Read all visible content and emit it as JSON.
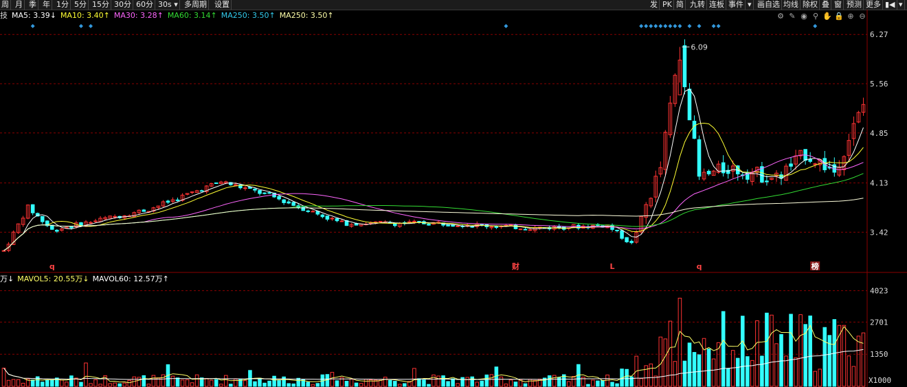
{
  "toolbar": {
    "left_buttons": [
      "周",
      "月",
      "季",
      "年",
      "1分",
      "5分",
      "15分",
      "30分",
      "60分",
      "30s ▾",
      "多周期",
      "设置"
    ],
    "right_buttons": [
      "发",
      "PK",
      "简",
      "九转",
      "连板",
      "事件",
      "▾",
      "画自选",
      "均线",
      "除权",
      "叠",
      "窗",
      "预测",
      "更多",
      "▮◀",
      "▾"
    ]
  },
  "ma_legend": {
    "title_char": "技",
    "items": [
      {
        "text": "MA5: 3.39↓",
        "color": "#ffffff"
      },
      {
        "text": "MA10: 3.40↑",
        "color": "#ffff33"
      },
      {
        "text": "MA30: 3.28↑",
        "color": "#ff66ff"
      },
      {
        "text": "MA60: 3.14↑",
        "color": "#33dd33"
      },
      {
        "text": "MA250: 3.50↑",
        "color": "#33ccee"
      },
      {
        "text": "MA250: 3.50↑",
        "color": "#ffffaa"
      }
    ]
  },
  "vol_legend": {
    "items": [
      {
        "text": "万↓",
        "color": "#ffffff"
      },
      {
        "text": "MAVOL5: 20.55万↓",
        "color": "#ffff66"
      },
      {
        "text": "MAVOL60: 12.57万↑",
        "color": "#ffffff"
      }
    ]
  },
  "tool_icons": [
    "gear-icon",
    "brush-icon",
    "eye-icon",
    "pin-icon",
    "hand-icon",
    "lock-icon",
    "zoom-in-icon",
    "zoom-out-icon"
  ],
  "tool_glyphs": [
    "⚙",
    "✎",
    "◉",
    "⚲",
    "✋",
    "🔒",
    "⊕",
    "⊖"
  ],
  "event_markers": [
    {
      "label": "q",
      "color": "#ff4444"
    },
    {
      "label": "财",
      "color": "#ff4444"
    },
    {
      "label": "L",
      "color": "#ff4444"
    },
    {
      "label": "q",
      "color": "#ff4444"
    },
    {
      "label": "榜",
      "color": "#ffffff",
      "boxed": true
    }
  ],
  "colors": {
    "up": "#ff3333",
    "down": "#33ffff",
    "grid": "#8b0000",
    "bg": "#000000"
  },
  "chart_data": [
    {
      "type": "candlestick",
      "price_axis_ticks": [
        "6.27",
        "5.56",
        "4.85",
        "4.13",
        "3.42"
      ],
      "price_axis_values": [
        6.27,
        5.56,
        4.85,
        4.13,
        3.42
      ],
      "ylim": [
        2.85,
        6.45
      ],
      "max_label": "6.09",
      "num_bars": 178,
      "key_points": [
        {
          "bar": 0,
          "price": 3.15
        },
        {
          "bar": 5,
          "price": 3.78
        },
        {
          "bar": 10,
          "price": 3.45
        },
        {
          "bar": 30,
          "price": 3.75
        },
        {
          "bar": 45,
          "price": 4.15
        },
        {
          "bar": 55,
          "price": 3.95
        },
        {
          "bar": 70,
          "price": 3.55
        },
        {
          "bar": 90,
          "price": 3.55
        },
        {
          "bar": 110,
          "price": 3.48
        },
        {
          "bar": 125,
          "price": 3.52
        },
        {
          "bar": 130,
          "price": 3.25
        },
        {
          "bar": 136,
          "price": 4.35
        },
        {
          "bar": 140,
          "price": 6.09
        },
        {
          "bar": 144,
          "price": 4.2
        },
        {
          "bar": 150,
          "price": 4.35
        },
        {
          "bar": 160,
          "price": 4.2
        },
        {
          "bar": 166,
          "price": 4.55
        },
        {
          "bar": 172,
          "price": 4.3
        },
        {
          "bar": 178,
          "price": 5.25
        }
      ],
      "ma_lines": [
        {
          "name": "MA5",
          "color": "#ffffff",
          "period": 5
        },
        {
          "name": "MA10",
          "color": "#ffff33",
          "period": 10
        },
        {
          "name": "MA30",
          "color": "#ff66ff",
          "period": 30
        },
        {
          "name": "MA60",
          "color": "#33dd33",
          "period": 60
        },
        {
          "name": "MA250",
          "color": "#ffffdd",
          "period": 250
        }
      ]
    },
    {
      "type": "bar",
      "volume_axis_ticks": [
        "4023",
        "2701",
        "1350"
      ],
      "volume_axis_values": [
        4023,
        2701,
        1350
      ],
      "unit_label": "X1000",
      "ylim": [
        0,
        4300
      ]
    }
  ]
}
